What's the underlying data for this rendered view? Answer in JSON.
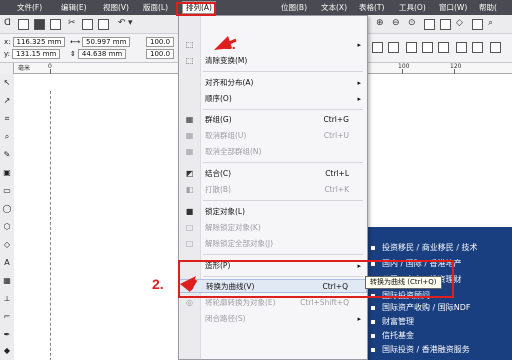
{
  "menubar": {
    "items": [
      "文件(F)",
      "编辑(E)",
      "视图(V)",
      "版面(L)",
      "排列(A)",
      "位图(B)",
      "文本(X)",
      "表格(T)",
      "工具(O)",
      "窗口(W)",
      "帮助("
    ],
    "active_index": 4
  },
  "property_bar": {
    "x_label": "x:",
    "x_value": "116.325 mm",
    "y_label": "y:",
    "y_value": "131.15 mm",
    "w_value": "50.997 mm",
    "h_value": "44.638 mm",
    "scale_1": "100.0",
    "scale_2": "100.0"
  },
  "ruler": {
    "units": "毫米",
    "h_numbers": [
      "0",
      "100",
      "120"
    ]
  },
  "menu": {
    "rows": [
      {
        "icon": "transform-icon",
        "glyph": "⬚",
        "label": "",
        "shortcut": "",
        "submenu": true,
        "disabled": false
      },
      {
        "icon": "clear-transform-icon",
        "glyph": "⬚",
        "label": "清除变换(M)",
        "shortcut": "",
        "submenu": false,
        "disabled": false
      },
      {
        "icon": "",
        "glyph": "",
        "label": "对齐和分布(A)",
        "shortcut": "",
        "submenu": true,
        "disabled": false
      },
      {
        "icon": "",
        "glyph": "",
        "label": "顺序(O)",
        "shortcut": "",
        "submenu": true,
        "disabled": false
      },
      {
        "icon": "group-icon",
        "glyph": "▦",
        "label": "群组(G)",
        "shortcut": "Ctrl+G",
        "submenu": false,
        "disabled": false
      },
      {
        "icon": "ungroup-icon",
        "glyph": "▦",
        "label": "取消群组(U)",
        "shortcut": "Ctrl+U",
        "submenu": false,
        "disabled": true
      },
      {
        "icon": "ungroup-all-icon",
        "glyph": "▦",
        "label": "取消全部群组(N)",
        "shortcut": "",
        "submenu": false,
        "disabled": true
      },
      {
        "icon": "combine-icon",
        "glyph": "◩",
        "label": "结合(C)",
        "shortcut": "Ctrl+L",
        "submenu": false,
        "disabled": false
      },
      {
        "icon": "break-apart-icon",
        "glyph": "◧",
        "label": "打散(B)",
        "shortcut": "Ctrl+K",
        "submenu": false,
        "disabled": true
      },
      {
        "icon": "lock-icon",
        "glyph": "🔒",
        "label": "锁定对象(L)",
        "shortcut": "",
        "submenu": false,
        "disabled": false
      },
      {
        "icon": "unlock-icon",
        "glyph": "🔓",
        "label": "解除锁定对象(K)",
        "shortcut": "",
        "submenu": false,
        "disabled": true
      },
      {
        "icon": "unlock-all-icon",
        "glyph": "🔓",
        "label": "解除锁定全部对象(J)",
        "shortcut": "",
        "submenu": false,
        "disabled": true
      },
      {
        "icon": "",
        "glyph": "",
        "label": "造形(P)",
        "shortcut": "",
        "submenu": true,
        "disabled": false
      },
      {
        "icon": "convert-to-curves-icon",
        "glyph": "◎",
        "label": "转换为曲线(V)",
        "shortcut": "Ctrl+Q",
        "submenu": false,
        "disabled": false
      },
      {
        "icon": "outline-to-object-icon",
        "glyph": "◎",
        "label": "将轮廓转换为对象(E)",
        "shortcut": "Ctrl+Shift+Q",
        "submenu": false,
        "disabled": true
      },
      {
        "icon": "",
        "glyph": "",
        "label": "闭合路径(S)",
        "shortcut": "",
        "submenu": true,
        "disabled": true
      }
    ]
  },
  "tooltip": "转换为曲线 (Ctrl+Q)",
  "annotations": {
    "step1": "1.",
    "step2": "2."
  },
  "blue_panel": {
    "lines": [
      "投资移民 / 商业移民 / 技术",
      "国内 / 国际 / 香港地产",
      "公司 / 个人 / 投资理财",
      "国际投资顾问",
      "国际资产收购 / 国际NDF",
      "财富管理",
      "信托基金",
      "国际投资 / 香港融资服务"
    ]
  },
  "colors": {
    "menubar": "#4a4a52",
    "annotation_red": "#e01e1e",
    "blue_panel": "#1a3f80"
  }
}
